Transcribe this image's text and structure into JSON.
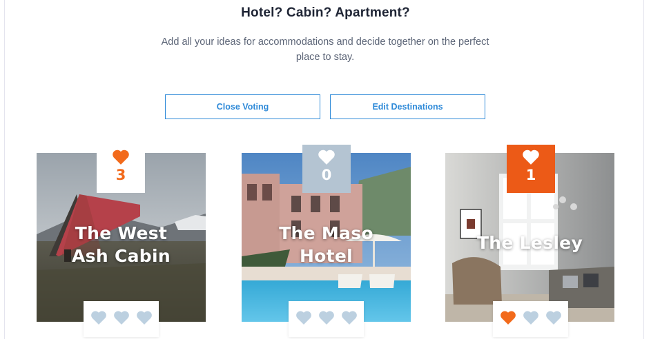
{
  "header": {
    "title": "Hotel? Cabin? Apartment?",
    "subtitle": "Add all your ideas for accommodations and decide together on the perfect place to stay."
  },
  "actions": {
    "close_voting": "Close Voting",
    "edit_destinations": "Edit Destinations"
  },
  "colors": {
    "accent_blue": "#2f8ad8",
    "vote_orange": "#f26a1b",
    "heart_idle": "#bcd0e0"
  },
  "cards": [
    {
      "name_line1": "The West",
      "name_line2": "Ash Cabin",
      "votes": "3",
      "my_votes": 0,
      "max_votes": 3
    },
    {
      "name_line1": "The Maso",
      "name_line2": "Hotel",
      "votes": "0",
      "my_votes": 0,
      "max_votes": 3
    },
    {
      "name_line1": "The Lesley",
      "name_line2": "",
      "votes": "1",
      "my_votes": 1,
      "max_votes": 3
    }
  ]
}
